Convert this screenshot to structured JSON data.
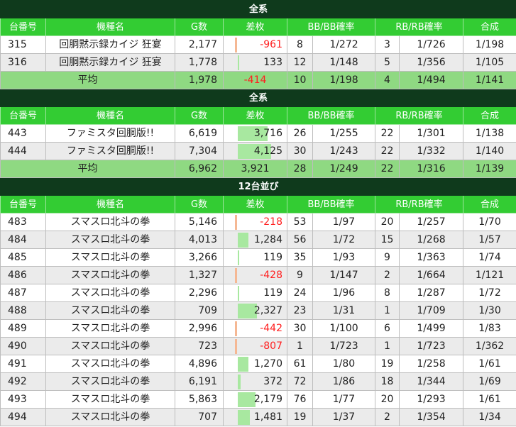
{
  "headers": {
    "no": "台番号",
    "name": "機種名",
    "games": "G数",
    "diff": "差枚",
    "bb": "BB/BB確率",
    "rb": "RB/RB確率",
    "total": "合成"
  },
  "sections": [
    {
      "title": "全系",
      "rows": [
        {
          "no": "315",
          "name": "回胴黙示録カイジ 狂宴",
          "games": "2,177",
          "diff": "-961",
          "diff_value": -961,
          "bb": "8",
          "bb_rate": "1/272",
          "rb": "3",
          "rb_rate": "1/726",
          "total": "1/198"
        },
        {
          "no": "316",
          "name": "回胴黙示録カイジ 狂宴",
          "games": "1,778",
          "diff": "133",
          "diff_value": 133,
          "bb": "12",
          "bb_rate": "1/148",
          "rb": "5",
          "rb_rate": "1/356",
          "total": "1/105"
        }
      ],
      "avg": {
        "label": "平均",
        "games": "1,978",
        "diff": "-414",
        "diff_value": -414,
        "bb": "10",
        "bb_rate": "1/198",
        "rb": "4",
        "rb_rate": "1/494",
        "total": "1/141"
      }
    },
    {
      "title": "全系",
      "rows": [
        {
          "no": "443",
          "name": "ファミスタ回胴版!!",
          "games": "6,619",
          "diff": "3,716",
          "diff_value": 3716,
          "bb": "26",
          "bb_rate": "1/255",
          "rb": "22",
          "rb_rate": "1/301",
          "total": "1/138"
        },
        {
          "no": "444",
          "name": "ファミスタ回胴版!!",
          "games": "7,304",
          "diff": "4,125",
          "diff_value": 4125,
          "bb": "30",
          "bb_rate": "1/243",
          "rb": "22",
          "rb_rate": "1/332",
          "total": "1/140"
        }
      ],
      "avg": {
        "label": "平均",
        "games": "6,962",
        "diff": "3,921",
        "diff_value": 3921,
        "bb": "28",
        "bb_rate": "1/249",
        "rb": "22",
        "rb_rate": "1/316",
        "total": "1/139"
      }
    },
    {
      "title": "12台並び",
      "rows": [
        {
          "no": "483",
          "name": "スマスロ北斗の拳",
          "games": "5,146",
          "diff": "-218",
          "diff_value": -218,
          "bb": "53",
          "bb_rate": "1/97",
          "rb": "20",
          "rb_rate": "1/257",
          "total": "1/70"
        },
        {
          "no": "484",
          "name": "スマスロ北斗の拳",
          "games": "4,013",
          "diff": "1,284",
          "diff_value": 1284,
          "bb": "56",
          "bb_rate": "1/72",
          "rb": "15",
          "rb_rate": "1/268",
          "total": "1/57"
        },
        {
          "no": "485",
          "name": "スマスロ北斗の拳",
          "games": "3,266",
          "diff": "119",
          "diff_value": 119,
          "bb": "35",
          "bb_rate": "1/93",
          "rb": "9",
          "rb_rate": "1/363",
          "total": "1/74"
        },
        {
          "no": "486",
          "name": "スマスロ北斗の拳",
          "games": "1,327",
          "diff": "-428",
          "diff_value": -428,
          "bb": "9",
          "bb_rate": "1/147",
          "rb": "2",
          "rb_rate": "1/664",
          "total": "1/121"
        },
        {
          "no": "487",
          "name": "スマスロ北斗の拳",
          "games": "2,296",
          "diff": "119",
          "diff_value": 119,
          "bb": "24",
          "bb_rate": "1/96",
          "rb": "8",
          "rb_rate": "1/287",
          "total": "1/72"
        },
        {
          "no": "488",
          "name": "スマスロ北斗の拳",
          "games": "709",
          "diff": "2,327",
          "diff_value": 2327,
          "bb": "23",
          "bb_rate": "1/31",
          "rb": "1",
          "rb_rate": "1/709",
          "total": "1/30"
        },
        {
          "no": "489",
          "name": "スマスロ北斗の拳",
          "games": "2,996",
          "diff": "-442",
          "diff_value": -442,
          "bb": "30",
          "bb_rate": "1/100",
          "rb": "6",
          "rb_rate": "1/499",
          "total": "1/83"
        },
        {
          "no": "490",
          "name": "スマスロ北斗の拳",
          "games": "723",
          "diff": "-807",
          "diff_value": -807,
          "bb": "1",
          "bb_rate": "1/723",
          "rb": "1",
          "rb_rate": "1/723",
          "total": "1/362"
        },
        {
          "no": "491",
          "name": "スマスロ北斗の拳",
          "games": "4,896",
          "diff": "1,270",
          "diff_value": 1270,
          "bb": "61",
          "bb_rate": "1/80",
          "rb": "19",
          "rb_rate": "1/258",
          "total": "1/61"
        },
        {
          "no": "492",
          "name": "スマスロ北斗の拳",
          "games": "6,191",
          "diff": "372",
          "diff_value": 372,
          "bb": "72",
          "bb_rate": "1/86",
          "rb": "18",
          "rb_rate": "1/344",
          "total": "1/69"
        },
        {
          "no": "493",
          "name": "スマスロ北斗の拳",
          "games": "5,863",
          "diff": "2,179",
          "diff_value": 2179,
          "bb": "76",
          "bb_rate": "1/77",
          "rb": "20",
          "rb_rate": "1/293",
          "total": "1/61"
        },
        {
          "no": "494",
          "name": "スマスロ北斗の拳",
          "games": "707",
          "diff": "1,481",
          "diff_value": 1481,
          "bb": "19",
          "bb_rate": "1/37",
          "rb": "2",
          "rb_rate": "1/354",
          "total": "1/34"
        }
      ]
    }
  ],
  "colors": {
    "title_bg": "#0f3a1c",
    "header_bg": "#33cc33",
    "avg_bg": "#8fd982",
    "row_alt_bg": "#ebebeb",
    "positive_bar": "#a8e8a0",
    "negative_bar": "#f5b894",
    "negative_text": "#ff2020"
  }
}
